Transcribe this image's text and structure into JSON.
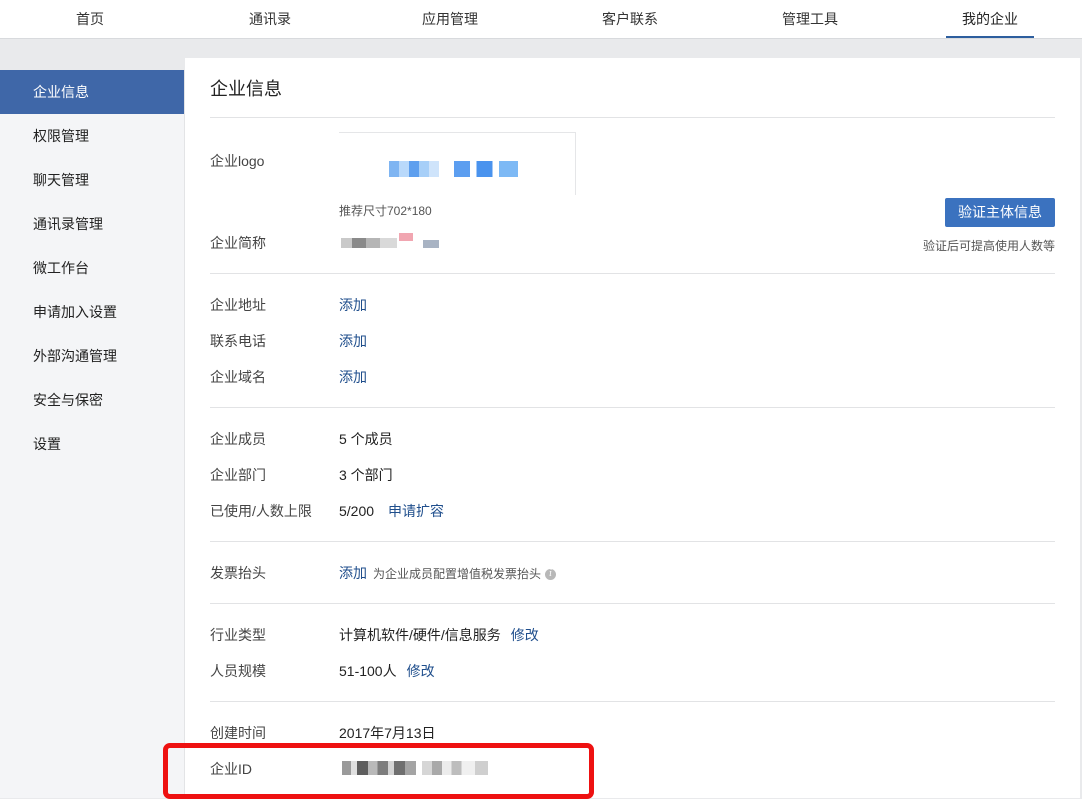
{
  "nav": {
    "tabs": [
      "首页",
      "通讯录",
      "应用管理",
      "客户联系",
      "管理工具",
      "我的企业"
    ],
    "active_tab": "我的企业",
    "accent_color": "#2d5e9e"
  },
  "sidebar": {
    "items": [
      "企业信息",
      "权限管理",
      "聊天管理",
      "通讯录管理",
      "微工作台",
      "申请加入设置",
      "外部沟通管理",
      "安全与保密",
      "设置"
    ],
    "active_item": "企业信息",
    "active_color": "#3f67a8"
  },
  "main": {
    "title": "企业信息",
    "logo": {
      "label": "企业logo",
      "size_hint": "推荐尺寸702*180"
    },
    "short_name": {
      "label": "企业简称"
    },
    "verify": {
      "button": "验证主体信息",
      "hint": "验证后可提高使用人数等",
      "button_color": "#3b72bf"
    },
    "contact": {
      "address_label": "企业地址",
      "address_action": "添加",
      "phone_label": "联系电话",
      "phone_action": "添加",
      "domain_label": "企业域名",
      "domain_action": "添加"
    },
    "stats": {
      "members_label": "企业成员",
      "members_value": "5 个成员",
      "departments_label": "企业部门",
      "departments_value": "3 个部门",
      "limit_label": "已使用/人数上限",
      "limit_value": "5/200",
      "limit_action": "申请扩容"
    },
    "invoice": {
      "label": "发票抬头",
      "action": "添加",
      "note": "为企业成员配置增值税发票抬头"
    },
    "industry": {
      "type_label": "行业类型",
      "type_value": "计算机软件/硬件/信息服务",
      "type_action": "修改",
      "scale_label": "人员规模",
      "scale_value": "51-100人",
      "scale_action": "修改"
    },
    "meta": {
      "created_label": "创建时间",
      "created_value": "2017年7月13日",
      "id_label": "企业ID"
    },
    "highlight_color": "#ee1111"
  }
}
